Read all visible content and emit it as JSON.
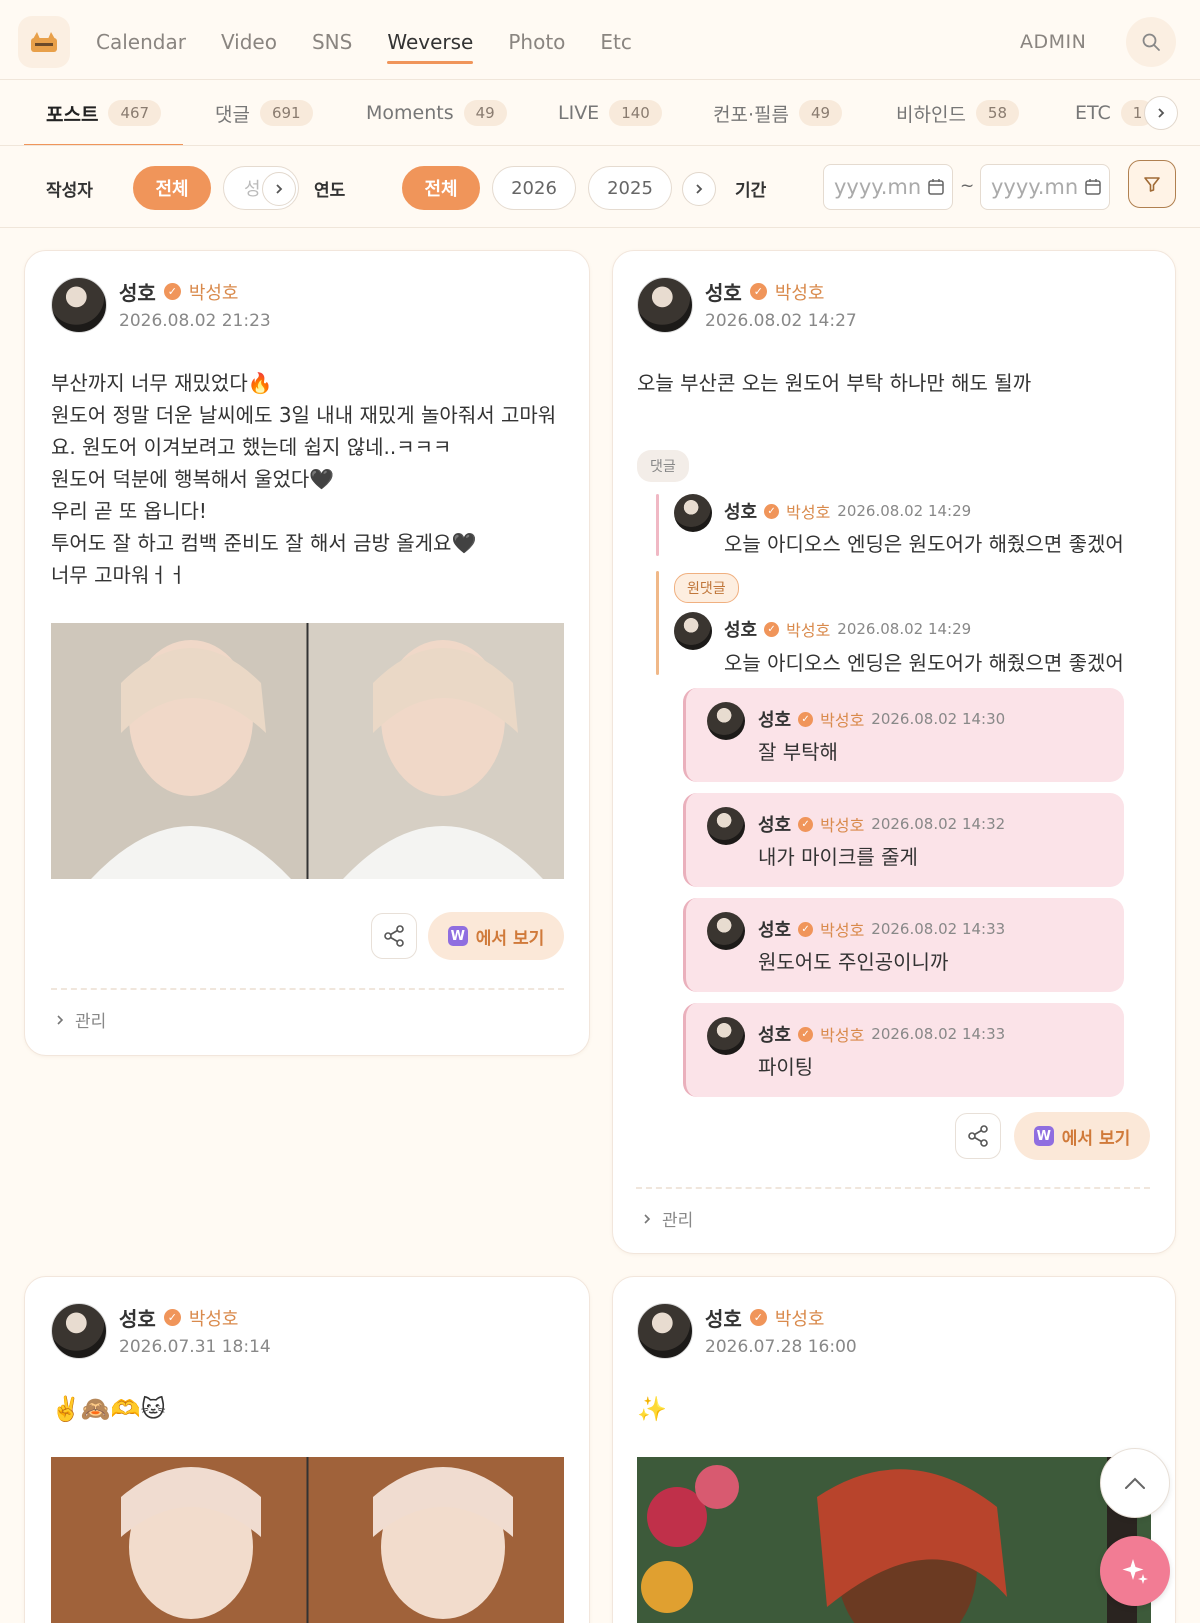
{
  "nav": {
    "items": [
      "Calendar",
      "Video",
      "SNS",
      "Weverse",
      "Photo",
      "Etc"
    ],
    "active": "Weverse",
    "admin": "ADMIN"
  },
  "categories": [
    {
      "label": "포스트",
      "count": "467"
    },
    {
      "label": "댓글",
      "count": "691"
    },
    {
      "label": "Moments",
      "count": "49"
    },
    {
      "label": "LIVE",
      "count": "140"
    },
    {
      "label": "컨포·필름",
      "count": "49"
    },
    {
      "label": "비하인드",
      "count": "58"
    },
    {
      "label": "ETC",
      "count": "1"
    }
  ],
  "filters": {
    "author_label": "작성자",
    "author_all": "전체",
    "author_next": "성",
    "year_label": "연도",
    "year_all": "전체",
    "years": [
      "2026",
      "2025"
    ],
    "period_label": "기간",
    "date_placeholder": "yyyy.mn",
    "date_sep": "~"
  },
  "posts": [
    {
      "author": "성호",
      "realname": "박성호",
      "date": "2026.08.02 21:23",
      "text": "부산까지 너무 재밌었다🔥\n원도어 정말 더운 날씨에도 3일 내내 재밌게 놀아줘서 고마워\n요. 원도어 이겨보려고 했는데 쉽지 않네..ㅋㅋㅋ\n원도어 덕분에 행복해서 울었다🖤\n우리 곧 또 옵니다!\n투어도 잘 하고 컴백 준비도 잘 해서 금방 올게요🖤\n너무 고마워ㅓㅓ",
      "view_label": "에서 보기",
      "manage": "관리"
    },
    {
      "author": "성호",
      "realname": "박성호",
      "date": "2026.08.02 14:27",
      "text": "오늘 부산콘 오는 원도어 부탁 하나만 해도 될까",
      "comment_tag": "댓글",
      "orig_tag": "원댓글",
      "comments": [
        {
          "author": "성호",
          "realname": "박성호",
          "date": "2026.08.02 14:29",
          "text": "오늘 아디오스 엔딩은 원도어가 해줬으면 좋겠어"
        },
        {
          "author": "성호",
          "realname": "박성호",
          "date": "2026.08.02 14:29",
          "text": "오늘 아디오스 엔딩은 원도어가 해줬으면 좋겠어"
        }
      ],
      "replies": [
        {
          "author": "성호",
          "realname": "박성호",
          "date": "2026.08.02 14:30",
          "text": "잘 부탁해"
        },
        {
          "author": "성호",
          "realname": "박성호",
          "date": "2026.08.02 14:32",
          "text": "내가 마이크를 줄게"
        },
        {
          "author": "성호",
          "realname": "박성호",
          "date": "2026.08.02 14:33",
          "text": "원도어도 주인공이니까"
        },
        {
          "author": "성호",
          "realname": "박성호",
          "date": "2026.08.02 14:33",
          "text": "파이팅"
        }
      ],
      "view_label": "에서 보기",
      "manage": "관리"
    },
    {
      "author": "성호",
      "realname": "박성호",
      "date": "2026.07.31 18:14",
      "text": "✌️🙈🫶🐱"
    },
    {
      "author": "성호",
      "realname": "박성호",
      "date": "2026.07.28 16:00",
      "text": "✨"
    }
  ],
  "colors": {
    "accent": "#f0955a",
    "background": "#fffaf3",
    "reply_bg": "#fbe3e8",
    "fab": "#f27c94"
  },
  "icons": {
    "search": "search-icon",
    "filter": "funnel-icon",
    "share": "share-icon",
    "scroll_top": "chevron-up-icon",
    "ai": "sparkle-icon"
  }
}
